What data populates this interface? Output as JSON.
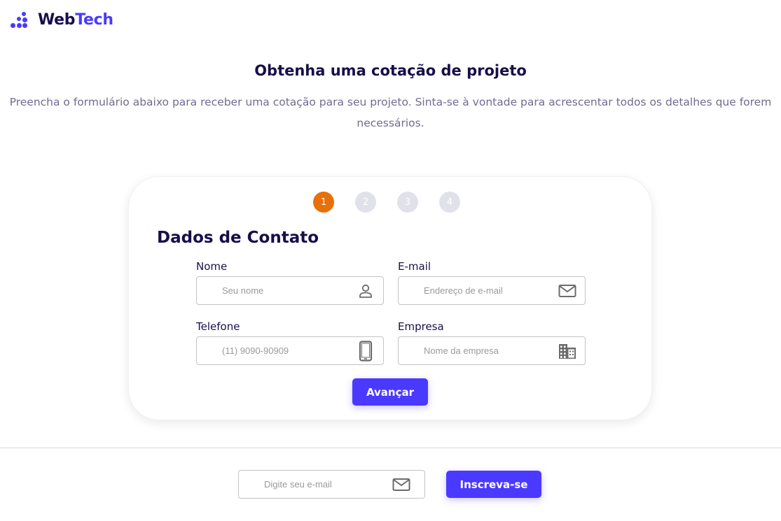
{
  "brand": {
    "name_part1": "Web",
    "name_part2": "Tech",
    "accent": "#4a3aff",
    "logo_icon": "dots-logo-icon"
  },
  "hero": {
    "title": "Obtenha uma cotação de projeto",
    "subtitle": "Preencha o formulário abaixo para receber uma cotação para seu projeto. Sinta-se à vontade para acrescentar todos os detalhes que forem necessários."
  },
  "steps": {
    "items": [
      "1",
      "2",
      "3",
      "4"
    ],
    "active_step": "1",
    "active_color": "#e8700a"
  },
  "form": {
    "section_title": "Dados de Contato",
    "name": {
      "label": "Nome",
      "placeholder": "Seu nome",
      "value": "",
      "icon": "user-icon"
    },
    "email": {
      "label": "E-mail",
      "placeholder": "Endereço de e-mail",
      "value": "",
      "icon": "envelope-icon"
    },
    "phone": {
      "label": "Telefone",
      "placeholder": "(11) 9090-90909",
      "value": "",
      "icon": "smartphone-icon"
    },
    "company": {
      "label": "Empresa",
      "placeholder": "Nome da empresa",
      "value": "",
      "icon": "building-icon"
    },
    "next_label": "Avançar"
  },
  "newsletter": {
    "placeholder": "Digite seu e-mail",
    "value": "",
    "icon": "envelope-icon",
    "subscribe_label": "Inscreva-se"
  }
}
